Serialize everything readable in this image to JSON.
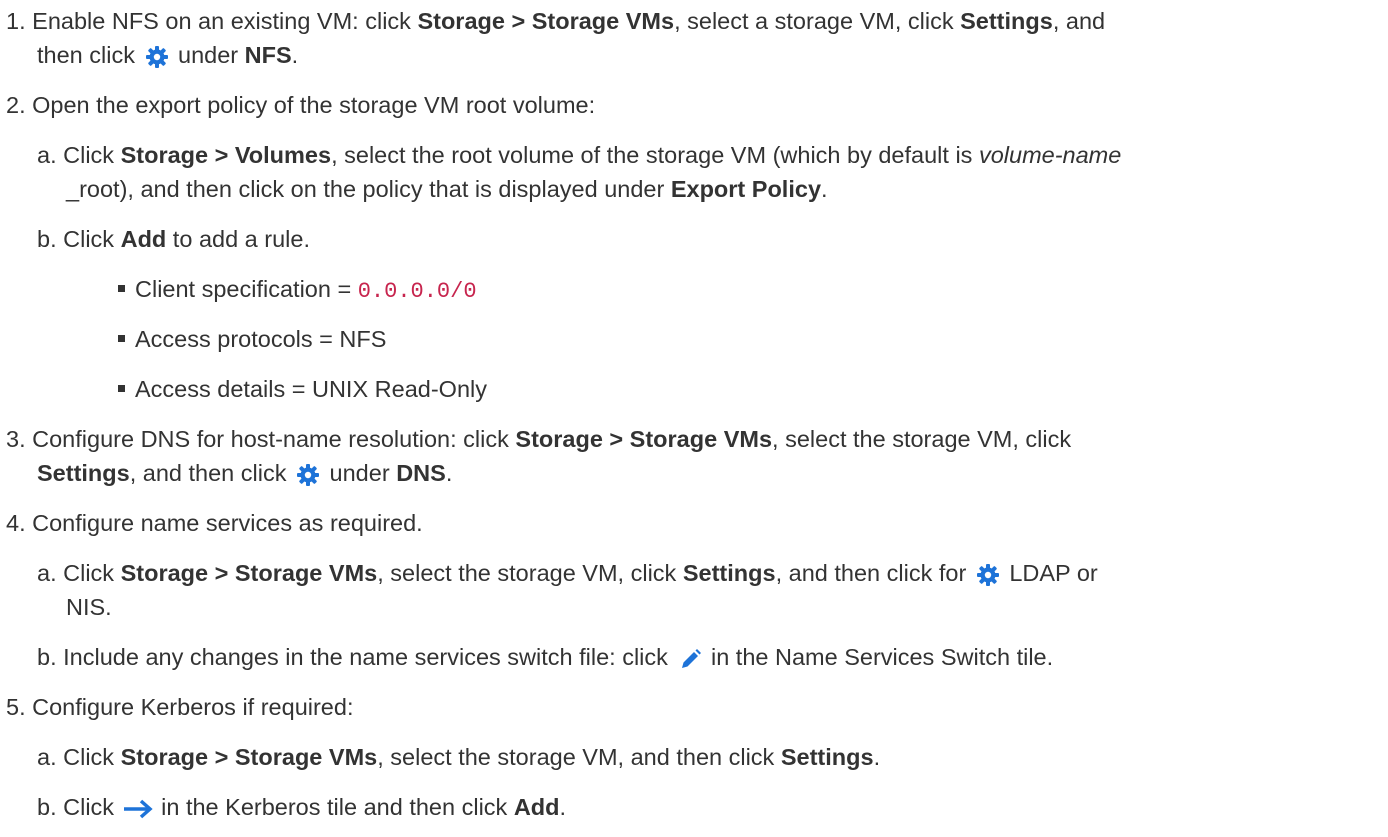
{
  "steps": [
    {
      "num": "1.",
      "l1": {
        "a": "Enable NFS on an existing VM: click ",
        "b1": "Storage > Storage VMs",
        "c": ", select a storage VM, click ",
        "b2": "Settings",
        "d": ", and"
      },
      "l2": {
        "a": "then click ",
        "icon": "gear-icon",
        "b": " under ",
        "b1": "NFS",
        "c": "."
      }
    },
    {
      "num": "2.",
      "text": "Open the export policy of the storage VM root volume:",
      "sub": [
        {
          "num": "a.",
          "l1": {
            "a": "Click ",
            "b1": "Storage > Volumes",
            "c": ", select the root volume of the storage VM (which by default is ",
            "i1": "volume-name"
          },
          "l2": {
            "a": "_root), and then click on the policy that is displayed under ",
            "b1": "Export Policy",
            "c": "."
          }
        },
        {
          "num": "b.",
          "l1": {
            "a": "Click ",
            "b1": "Add",
            "c": " to add a rule."
          },
          "bullets": [
            {
              "label": "Client specification = ",
              "code": "0.0.0.0/0"
            },
            {
              "label": "Access protocols = NFS"
            },
            {
              "label": "Access details = UNIX Read-Only"
            }
          ]
        }
      ]
    },
    {
      "num": "3.",
      "l1": {
        "a": "Configure DNS for host-name resolution: click ",
        "b1": "Storage > Storage VMs",
        "c": ", select the storage VM, click"
      },
      "l2": {
        "b1": "Settings",
        "a": ", and then click ",
        "icon": "gear-icon",
        "b": " under ",
        "b2": "DNS",
        "c": "."
      }
    },
    {
      "num": "4.",
      "text": "Configure name services as required.",
      "sub": [
        {
          "num": "a.",
          "l1": {
            "a": "Click ",
            "b1": "Storage > Storage VMs",
            "c": ", select the storage VM, click ",
            "b2": "Settings",
            "d": ", and then click for ",
            "icon": "gear-icon",
            "e": " LDAP or"
          },
          "l2": {
            "a": "NIS."
          }
        },
        {
          "num": "b.",
          "l1": {
            "a": "Include any changes in the name services switch file: click ",
            "icon": "pencil-icon",
            "b": " in the Name Services Switch tile."
          }
        }
      ]
    },
    {
      "num": "5.",
      "text": "Configure Kerberos if required:",
      "sub": [
        {
          "num": "a.",
          "l1": {
            "a": "Click ",
            "b1": "Storage > Storage VMs",
            "c": ", select the storage VM, and then click ",
            "b2": "Settings",
            "d": "."
          }
        },
        {
          "num": "b.",
          "l1": {
            "a": "Click ",
            "icon": "arrow-right-icon",
            "b": " in the Kerberos tile and then click ",
            "b1": "Add",
            "c": "."
          }
        }
      ]
    }
  ],
  "colors": {
    "text": "#333333",
    "icon": "#1e73d8",
    "code": "#c7254e"
  }
}
